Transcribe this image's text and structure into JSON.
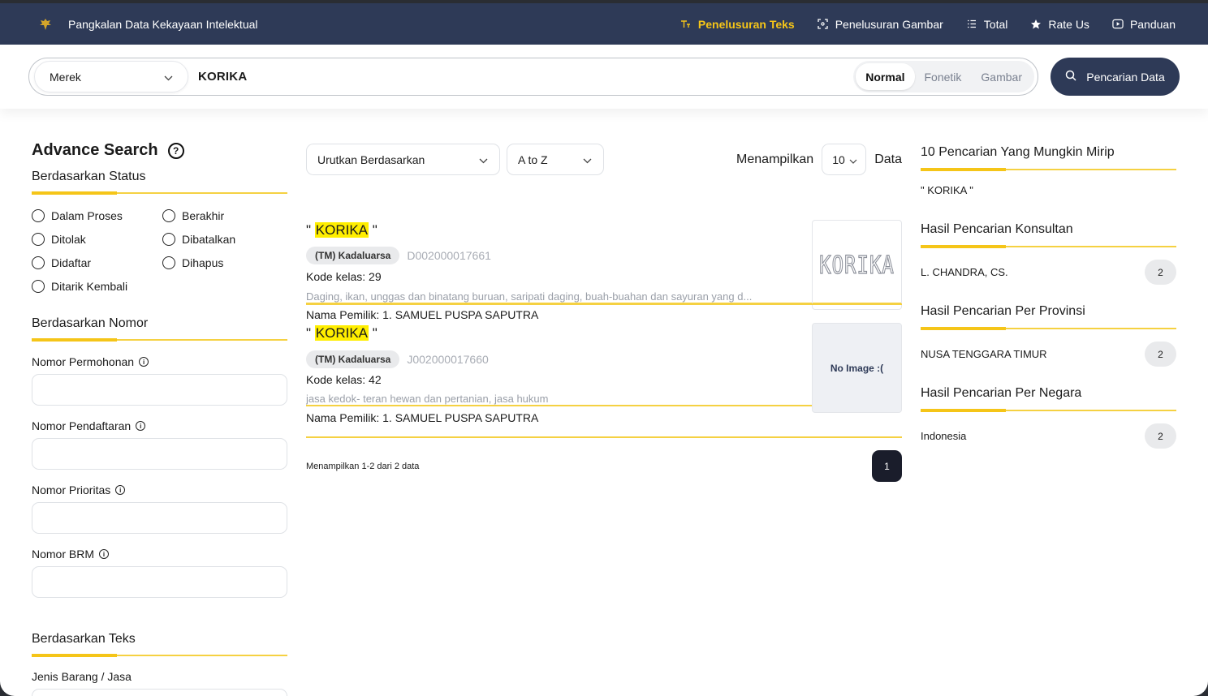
{
  "header": {
    "brand": "Pangkalan Data Kekayaan Intelektual",
    "nav": [
      {
        "label": "Penelusuran Teks",
        "icon": "text-search-icon",
        "active": true
      },
      {
        "label": "Penelusuran Gambar",
        "icon": "image-search-icon",
        "active": false
      },
      {
        "label": "Total",
        "icon": "list-icon",
        "active": false
      },
      {
        "label": "Rate Us",
        "icon": "star-icon",
        "active": false
      },
      {
        "label": "Panduan",
        "icon": "play-icon",
        "active": false
      }
    ]
  },
  "search": {
    "type": "Merek",
    "query": "KORIKA",
    "modes": [
      "Normal",
      "Fonetik",
      "Gambar"
    ],
    "active_mode": "Normal",
    "button": "Pencarian Data"
  },
  "left": {
    "title": "Advance Search",
    "status_title": "Berdasarkan Status",
    "statuses": [
      "Dalam Proses",
      "Berakhir",
      "Ditolak",
      "Dibatalkan",
      "Didaftar",
      "Dihapus",
      "Ditarik Kembali"
    ],
    "nomor_title": "Berdasarkan Nomor",
    "fields": [
      "Nomor Permohonan",
      "Nomor Pendaftaran",
      "Nomor Prioritas",
      "Nomor BRM"
    ],
    "teks_title": "Berdasarkan Teks",
    "teks_field": "Jenis Barang / Jasa"
  },
  "center": {
    "sort_label": "Urutkan Berdasarkan",
    "order": "A to Z",
    "show_label": "Menampilkan",
    "page_size": "10",
    "data_label": "Data",
    "results": [
      {
        "quote_open": "\"",
        "name": "KORIKA",
        "quote_close": "\"",
        "status": "(TM) Kadaluarsa",
        "number": "D002000017661",
        "kelas": "Kode kelas: 29",
        "desc": "Daging, ikan, unggas dan binatang buruan, saripati daging, buah-buahan dan sayuran yang d...",
        "owner": "Nama Pemilik: 1. SAMUEL PUSPA SAPUTRA",
        "image_text": "KORIKA"
      },
      {
        "quote_open": "\"",
        "name": "KORIKA",
        "quote_close": "\"",
        "status": "(TM) Kadaluarsa",
        "number": "J002000017660",
        "kelas": "Kode kelas: 42",
        "desc": "jasa kedok- teran hewan dan pertanian, jasa hukum",
        "owner": "Nama Pemilik: 1. SAMUEL PUSPA SAPUTRA",
        "image_text": "No Image :("
      }
    ],
    "footer_info": "Menampilkan 1-2 dari 2 data",
    "page": "1"
  },
  "right": {
    "similar_title": "10 Pencarian Yang Mungkin Mirip",
    "similar_item": "\" KORIKA \"",
    "konsultan_title": "Hasil Pencarian Konsultan",
    "konsultan": {
      "name": "L. CHANDRA, CS.",
      "count": "2"
    },
    "provinsi_title": "Hasil Pencarian Per Provinsi",
    "provinsi": {
      "name": "NUSA TENGGARA TIMUR",
      "count": "2"
    },
    "negara_title": "Hasil Pencarian Per Negara",
    "negara": {
      "name": "Indonesia",
      "count": "2"
    }
  }
}
